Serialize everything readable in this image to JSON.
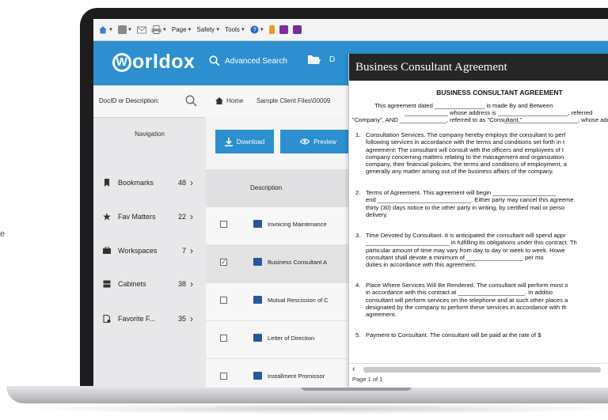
{
  "background": {
    "left_edge_letter": "e"
  },
  "browser_toolbar": {
    "items": [
      {
        "icon": "home-icon",
        "label": ""
      },
      {
        "icon": "feeds-icon",
        "label": ""
      },
      {
        "icon": "mail-icon",
        "label": ""
      },
      {
        "icon": "print-icon",
        "label": ""
      },
      {
        "icon": "",
        "label": "Page"
      },
      {
        "icon": "",
        "label": "Safety"
      },
      {
        "icon": "",
        "label": "Tools"
      },
      {
        "icon": "help-icon",
        "label": ""
      }
    ]
  },
  "header": {
    "logo_rest": "orldox",
    "logo_letter": "W",
    "advanced_search_label": "Advanced Search",
    "truncated_label": "D"
  },
  "sidebar": {
    "search_label": "DocID or Description:",
    "navigation_title": "Navigation",
    "items": [
      {
        "icon": "bookmark-icon",
        "label": "Bookmarks",
        "count": "48"
      },
      {
        "icon": "star-icon",
        "label": "Fav Matters",
        "count": "22"
      },
      {
        "icon": "workspace-icon",
        "label": "Workspaces",
        "count": "7"
      },
      {
        "icon": "cabinet-icon",
        "label": "Cabinets",
        "count": "38"
      },
      {
        "icon": "favorite-file-icon",
        "label": "Favorite F...",
        "count": "35"
      }
    ]
  },
  "breadcrumb": {
    "home": "Home",
    "path": "Sample Client Files\\00009"
  },
  "actions": {
    "download_label": "Download",
    "preview_label": "Preview"
  },
  "list": {
    "column_header": "Description",
    "rows": [
      {
        "label": "Invoicing Maintenance",
        "checked": false
      },
      {
        "label": "Business Consultant A",
        "checked": true
      },
      {
        "label": "Mutual Rescission of C",
        "checked": false
      },
      {
        "label": "Letter of Direction",
        "checked": false
      },
      {
        "label": "Installment Promissor",
        "checked": false
      }
    ]
  },
  "preview": {
    "title": "Business Consultant Agreement",
    "heading": "BUSINESS CONSULTANT AGREEMENT",
    "intro_lines": [
      "This agreement dated _______________ is made By and Between",
      "_____________ whose address is _____________________, referred",
      "\"Company\", AND ______________, referred to as \"Consultant.\""
    ],
    "intro_line3_end": "______________________, whose add",
    "paragraphs": [
      {
        "num": "1.",
        "lines": [
          "Consultation Services. The company hereby employs the consultant to perf",
          "following services in accordance with the terms and conditions set forth in t",
          "agreement: The consultant will consult with the officers and employees of t",
          "company concerning matters relating to the management and organization",
          "company, their financial policies, the terms and conditions of employment, a",
          "generally any matter arising out of the business affairs of the company."
        ]
      },
      {
        "num": "2.",
        "lines": [
          "Terms of Agreement. This agreement will begin ___________________",
          "end ____________________________. Either party may cancel this agreeme",
          "thirty (30) days notice to the other party in writing, by certified mail or perso",
          "delivery."
        ]
      },
      {
        "num": "3.",
        "lines": [
          "Time Devoted by Consultant. It is anticipated the consultant will spend appr",
          "_________________________ in fulfilling its obligations under this contract. Th",
          "particular amount of time may vary from day to day or week to week. Howe",
          "consultant shall devote a minimum of _________________ per mo",
          "duties in accordance with this agreement."
        ]
      },
      {
        "num": "4.",
        "lines": [
          "Place Where Services Will Be Rendered. The consultant will perform most o",
          "in accordance with this contract at ____________________. In additio",
          "consultant will perform services on the telephone and at such other places a",
          "designated by the company to perform these services in accordance with th",
          "agreement."
        ]
      },
      {
        "num": "5.",
        "lines": [
          "Payment to Consultant. The consultant will be paid at the rate of $"
        ]
      }
    ],
    "page_info": "Page 1 of 1"
  },
  "colors": {
    "accent": "#2d8fd0",
    "preview_title_bg": "#262626",
    "sidebar_bg": "#e8e8ea"
  }
}
